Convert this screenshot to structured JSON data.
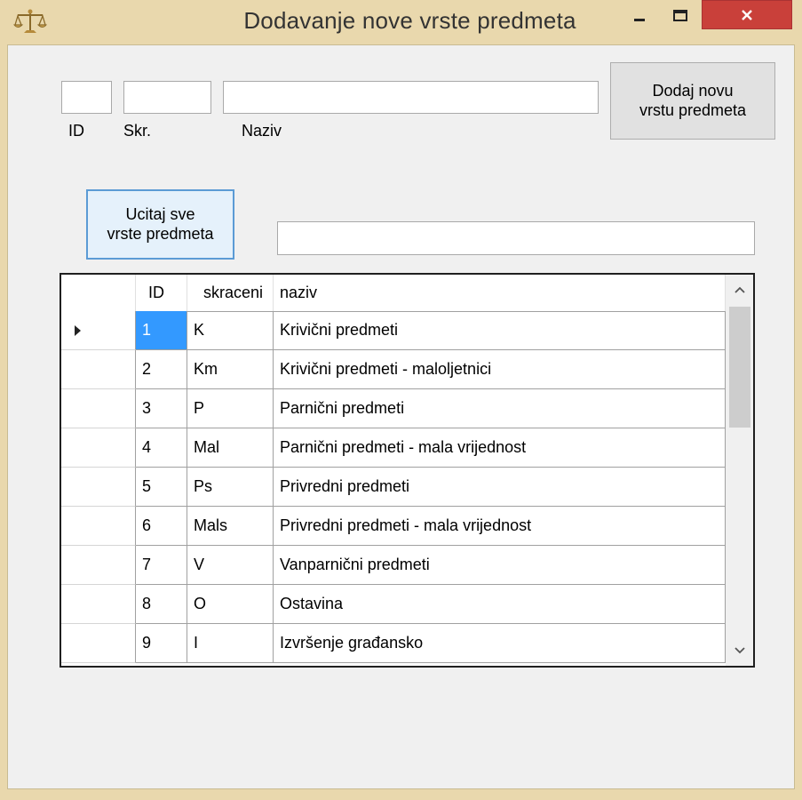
{
  "window": {
    "title": "Dodavanje nove vrste predmeta",
    "icons": {
      "app": "scales-icon",
      "minimize": "minimize-icon",
      "maximize": "maximize-icon",
      "close": "close-icon"
    }
  },
  "form": {
    "id_label": "ID",
    "skr_label": "Skr.",
    "naziv_label": "Naziv",
    "id_value": "",
    "skr_value": "",
    "naziv_value": "",
    "add_button_line1": "Dodaj novu",
    "add_button_line2": "vrstu predmeta",
    "load_button_line1": "Ucitaj sve",
    "load_button_line2": "vrste predmeta",
    "filter_value": ""
  },
  "grid": {
    "columns": [
      "ID",
      "skraceni",
      "naziv"
    ],
    "rows": [
      {
        "id": "1",
        "skr": "K",
        "naziv": "Krivični predmeti"
      },
      {
        "id": "2",
        "skr": "Km",
        "naziv": "Krivični predmeti - maloljetnici"
      },
      {
        "id": "3",
        "skr": "P",
        "naziv": "Parnični predmeti"
      },
      {
        "id": "4",
        "skr": "Mal",
        "naziv": "Parnični predmeti - mala vrijednost"
      },
      {
        "id": "5",
        "skr": "Ps",
        "naziv": "Privredni predmeti"
      },
      {
        "id": "6",
        "skr": "Mals",
        "naziv": "Privredni predmeti - mala vrijednost"
      },
      {
        "id": "7",
        "skr": "V",
        "naziv": "Vanparnični predmeti"
      },
      {
        "id": "8",
        "skr": "O",
        "naziv": "Ostavina"
      },
      {
        "id": "9",
        "skr": "I",
        "naziv": "Izvršenje građansko"
      }
    ],
    "selected_row": 0
  },
  "colors": {
    "frame": "#e9d8ad",
    "selection": "#3399ff",
    "close": "#c9403a"
  }
}
